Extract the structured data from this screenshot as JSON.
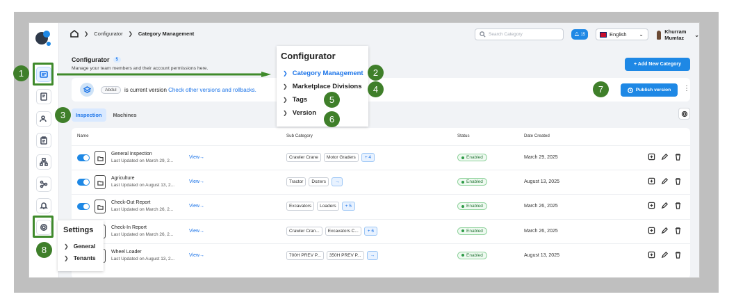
{
  "breadcrumb": {
    "parent": "Configurator",
    "current": "Category Management"
  },
  "search": {
    "placeholder": "Search Category"
  },
  "notifications": {
    "count": "15"
  },
  "language": {
    "label": "English"
  },
  "user": {
    "name": "Khurram Mumtaz"
  },
  "page": {
    "title": "Configurator",
    "count_badge": "5",
    "subtitle": "Manage your team members and their account permissions here.",
    "add_button": "+ Add New Category"
  },
  "version_bar": {
    "chip": "Abdul",
    "text": "is current version",
    "link": "Check other versions and rollbacks.",
    "publish": "Publish version"
  },
  "tabs": [
    "Inspection",
    "Machines"
  ],
  "table": {
    "headers": [
      "Name",
      "Sub Category",
      "Status",
      "Date Created"
    ],
    "rows": [
      {
        "name": "General Inspection",
        "updated": "Last Updated on March 29, 2...",
        "view": "View→",
        "subs": [
          "Crawler Crane",
          "Motor Graders"
        ],
        "more": "+ 4",
        "status": "Enabled",
        "date": "March 29, 2025"
      },
      {
        "name": "Agriculture",
        "updated": "Last Updated on August 13, 2...",
        "view": "View→",
        "subs": [
          "Tractor",
          "Dozers"
        ],
        "more": "→",
        "status": "Enabled",
        "date": "August 13, 2025"
      },
      {
        "name": "Check-Out Report",
        "updated": "Last Updated on March 26, 2...",
        "view": "View→",
        "subs": [
          "Excavators",
          "Loaders"
        ],
        "more": "+ 5",
        "status": "Enabled",
        "date": "March 26, 2025"
      },
      {
        "name": "Check-In Report",
        "updated": "Last Updated on March 26, 2...",
        "view": "View→",
        "subs": [
          "Crawler Cran...",
          "Excavators C..."
        ],
        "more": "+ 6",
        "status": "Enabled",
        "date": "March 26, 2025"
      },
      {
        "name": "Wheel Loader",
        "updated": "Last Updated on August 13, 2...",
        "view": "View→",
        "subs": [
          "700H PREV P...",
          "350H PREV P..."
        ],
        "more": "→",
        "status": "Enabled",
        "date": "August 13, 2025"
      }
    ]
  },
  "configurator_menu": {
    "title": "Configurator",
    "items": [
      "Category Management",
      "Marketplace Divisions",
      "Tags",
      "Version"
    ]
  },
  "settings_menu": {
    "title": "Settings",
    "items": [
      "General",
      "Tenants"
    ]
  },
  "callouts": [
    "1",
    "2",
    "3",
    "4",
    "5",
    "6",
    "7",
    "8"
  ],
  "colors": {
    "accent": "#1e88e5",
    "callout": "#3f7f2a",
    "enabled": "#2e9b47"
  }
}
